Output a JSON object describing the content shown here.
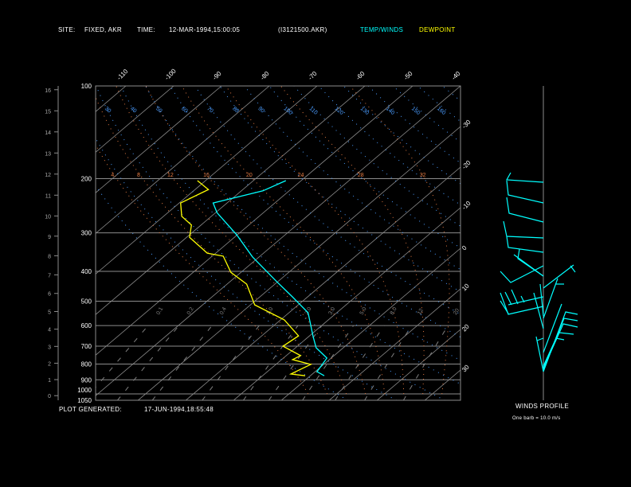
{
  "header": {
    "site_label": "SITE:",
    "site": "FIXED, AKR",
    "time_label": "TIME:",
    "time": "12-MAR-1994,15:00:05",
    "file": "(I3121500.AKR)",
    "legend_temp": "TEMP/WINDS",
    "legend_dew": "DEWPOINT"
  },
  "footer": {
    "plot_generated_label": "PLOT GENERATED:",
    "plot_generated": "17-JUN-1994,18:55:48"
  },
  "winds": {
    "title": "WINDS PROFILE",
    "barb_note": "One barb = 10.0 m/s"
  },
  "colors": {
    "temp": "#00ffff",
    "dewpoint": "#ffff00",
    "grid": "#8c8c8c",
    "dry_adiabat": "#4a9cff",
    "moist_adiabat": "#e07840",
    "mixing_ratio": "#808080"
  },
  "chart_data": {
    "type": "skew-t",
    "title": "",
    "pressure_levels": [
      "100",
      "200",
      "300",
      "400",
      "500",
      "600",
      "700",
      "800",
      "900",
      "1000",
      "1050"
    ],
    "height_km_ticks": [
      "0",
      "1",
      "2",
      "3",
      "4",
      "5",
      "6",
      "7",
      "8",
      "9",
      "10",
      "11",
      "12",
      "13",
      "14",
      "15",
      "16"
    ],
    "isotherm_top_labels": [
      "-110",
      "-100",
      "-90",
      "-80",
      "-70",
      "-60",
      "-50",
      "-40"
    ],
    "isotherm_right_labels": [
      "-30",
      "-20",
      "-10",
      "0",
      "10",
      "20",
      "30"
    ],
    "dry_adiabat_labels": [
      "30",
      "40",
      "50",
      "60",
      "70",
      "80",
      "90",
      "100",
      "110",
      "120",
      "130",
      "140",
      "150",
      "160"
    ],
    "moist_adiabat_labels": [
      "4",
      "8",
      "12",
      "16",
      "20",
      "24",
      "28",
      "32"
    ],
    "mixing_ratio_labels": [
      "0.1",
      "0.2",
      "0.4",
      "1.0",
      "2.0",
      "3.0",
      "5.0",
      "8.0",
      "12",
      "20"
    ],
    "xlim_degC_at_100hPa": [
      -116,
      -40
    ],
    "ylim_hPa": [
      1050,
      100
    ],
    "series": [
      {
        "name": "TEMP/WINDS",
        "points": [
          [
            873,
            2.9
          ],
          [
            847,
            0.4
          ],
          [
            765,
            -0.9
          ],
          [
            708,
            -5.7
          ],
          [
            651,
            -9.1
          ],
          [
            545,
            -16.0
          ],
          [
            484,
            -23.2
          ],
          [
            430,
            -30.5
          ],
          [
            359,
            -41.4
          ],
          [
            304,
            -50.2
          ],
          [
            258,
            -59.7
          ],
          [
            240,
            -62.9
          ],
          [
            229,
            -59.1
          ],
          [
            219,
            -55.5
          ],
          [
            203,
            -53.2
          ]
        ]
      },
      {
        "name": "DEWPOINT",
        "points": [
          [
            873,
            -1.1
          ],
          [
            862,
            -4.5
          ],
          [
            802,
            -2.7
          ],
          [
            774,
            -7.7
          ],
          [
            751,
            -7.0
          ],
          [
            700,
            -13.0
          ],
          [
            648,
            -12.3
          ],
          [
            575,
            -19.2
          ],
          [
            514,
            -29.1
          ],
          [
            440,
            -35.9
          ],
          [
            403,
            -42.1
          ],
          [
            357,
            -47.7
          ],
          [
            349,
            -51.8
          ],
          [
            310,
            -59.4
          ],
          [
            283,
            -62.0
          ],
          [
            265,
            -66.2
          ],
          [
            240,
            -69.7
          ],
          [
            217,
            -67.2
          ],
          [
            203,
            -71.7
          ]
        ]
      }
    ]
  }
}
